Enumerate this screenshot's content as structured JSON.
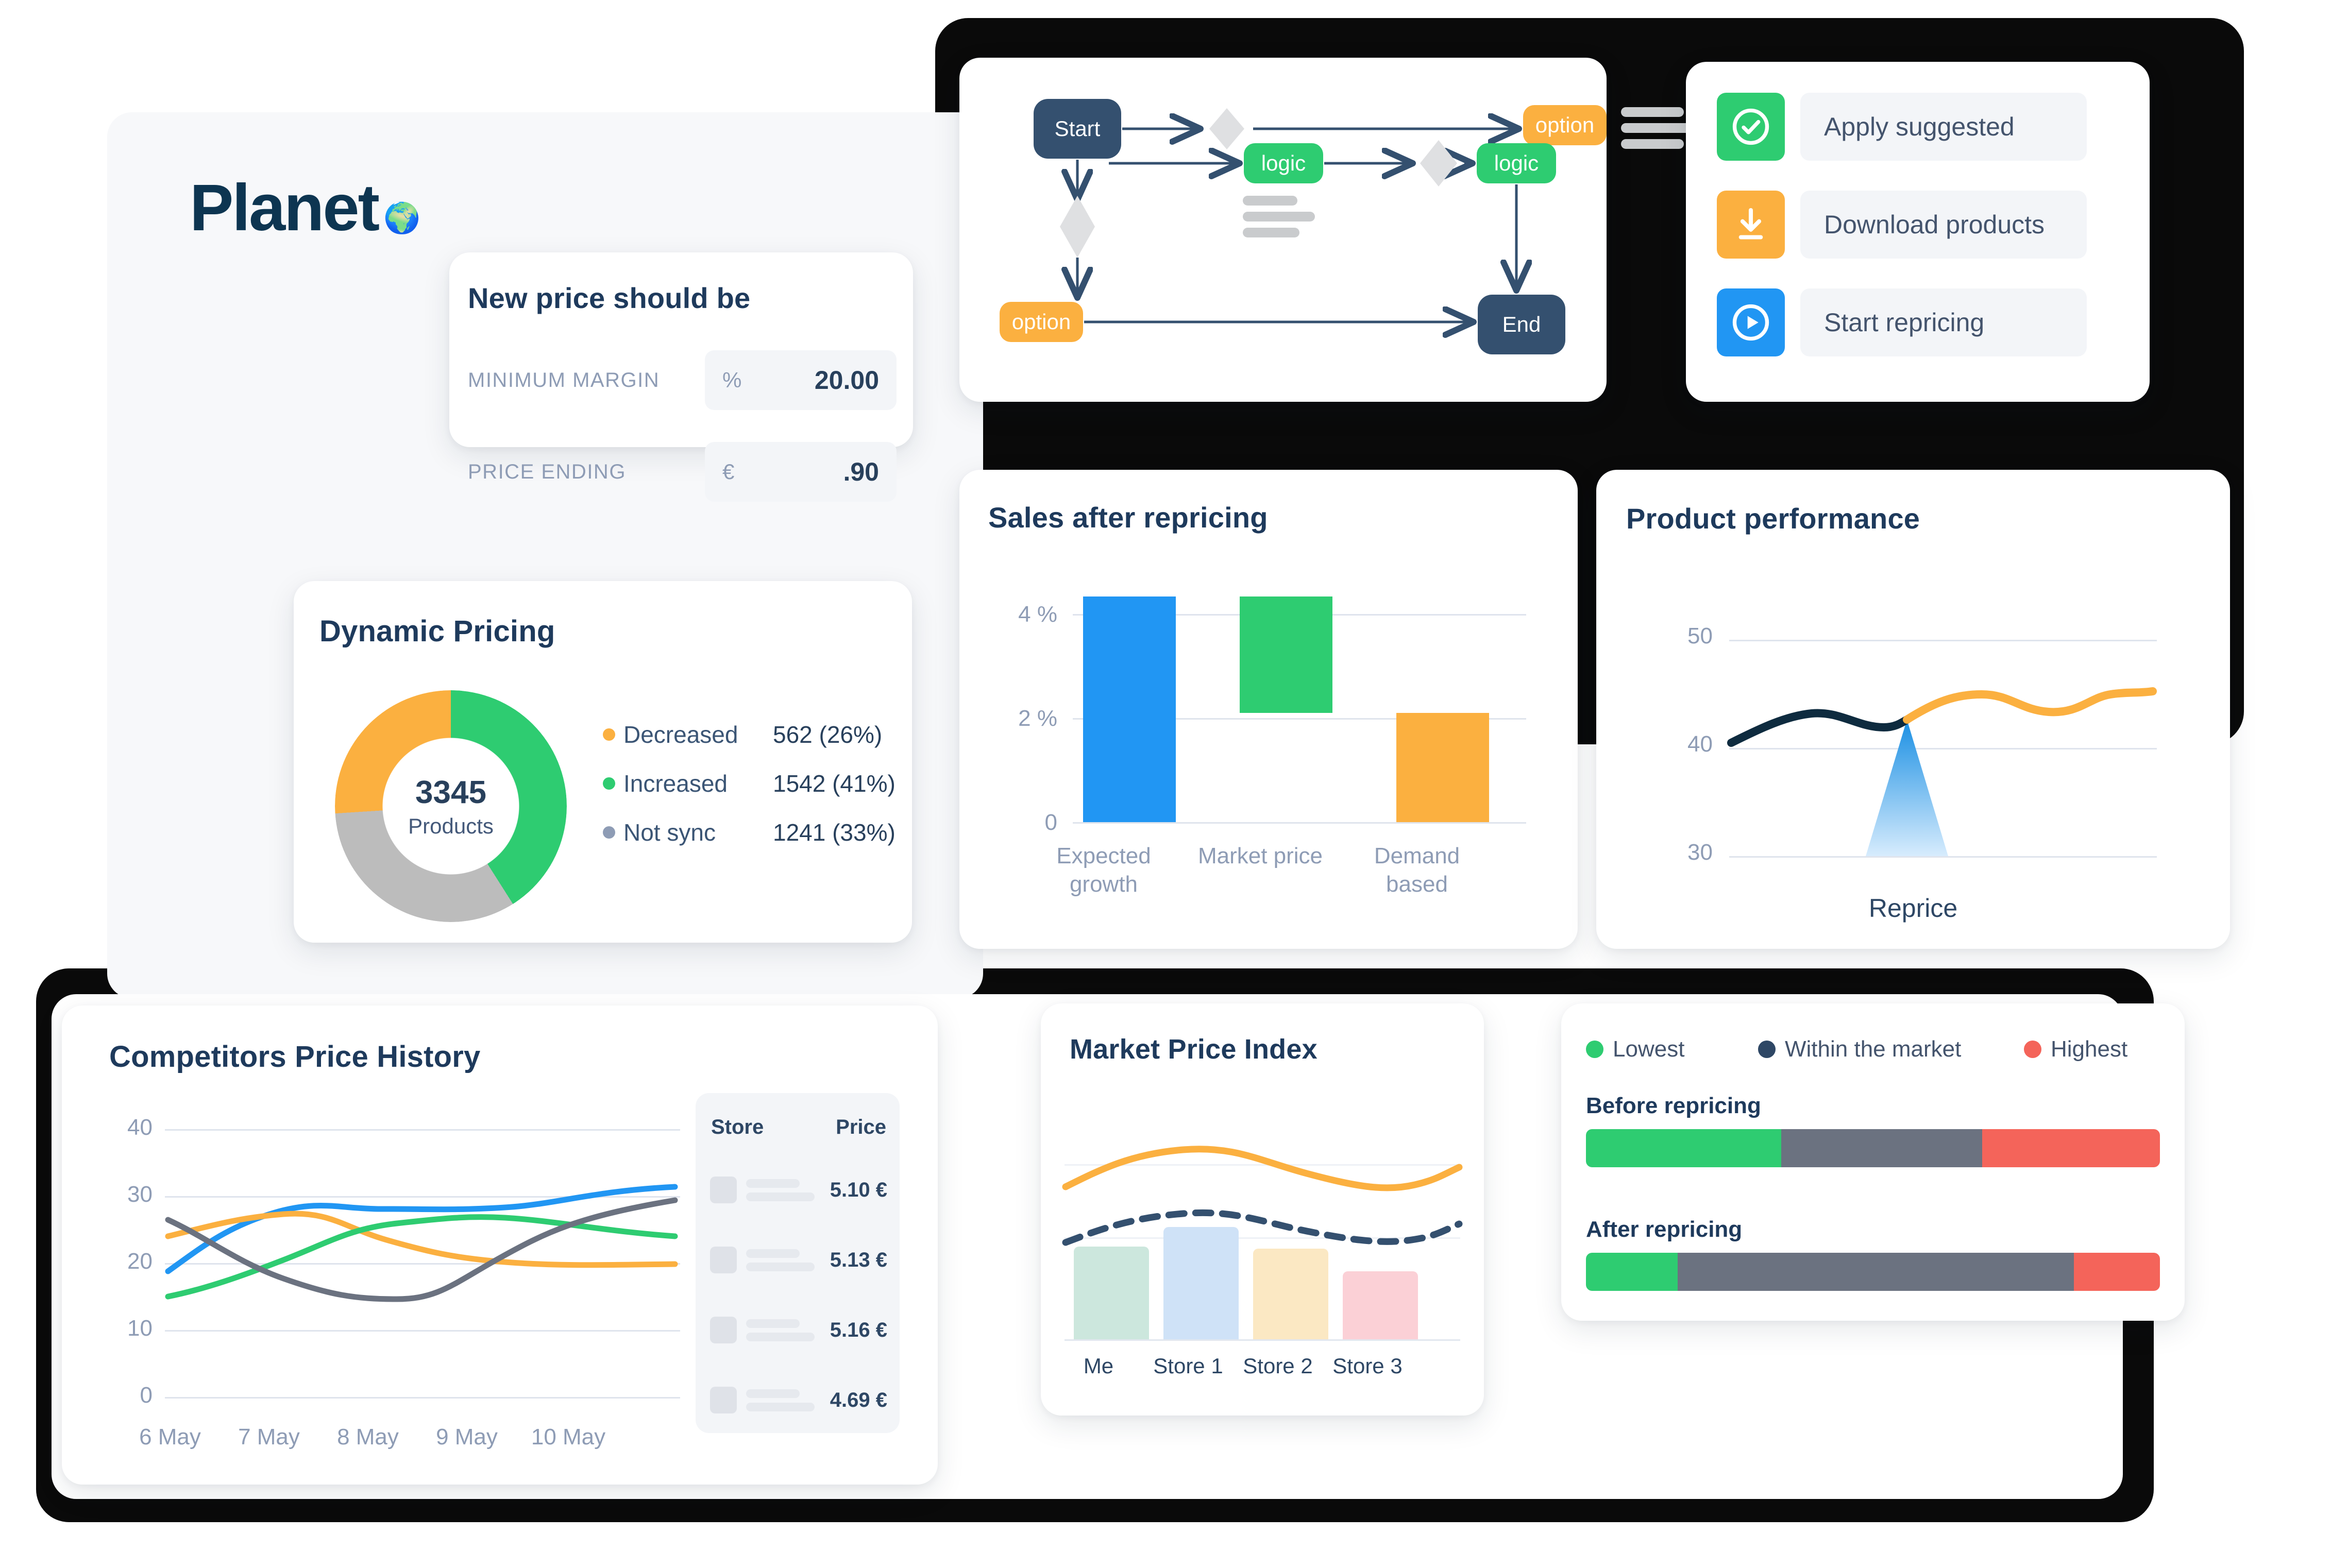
{
  "brand": {
    "name": "Planet",
    "dot_icon": "globe-emoji",
    "color": "#0d3551"
  },
  "new_price_card": {
    "title": "New price should be",
    "fields": [
      {
        "label": "MINIMUM MARGIN",
        "unit": "%",
        "value": "20.00"
      },
      {
        "label": "PRICE ENDING",
        "unit": "€",
        "value": ".90"
      }
    ]
  },
  "flow_card": {
    "nodes": [
      {
        "id": "start",
        "label": "Start",
        "type": "terminator",
        "color": "#34506f"
      },
      {
        "id": "opt1",
        "label": "option",
        "type": "option",
        "color": "#fbb040"
      },
      {
        "id": "opt2",
        "label": "option",
        "type": "option",
        "color": "#fbb040"
      },
      {
        "id": "logic1",
        "label": "logic",
        "type": "logic",
        "color": "#2ecc71"
      },
      {
        "id": "logic2",
        "label": "logic",
        "type": "logic",
        "color": "#2ecc71"
      },
      {
        "id": "end",
        "label": "End",
        "type": "terminator",
        "color": "#34506f"
      }
    ],
    "decision_count": 3,
    "arrow_color": "#34506f"
  },
  "actions_card": {
    "items": [
      {
        "label": "Apply suggested",
        "icon": "check-circle-icon",
        "color": "#2ecc71"
      },
      {
        "label": "Download products",
        "icon": "download-icon",
        "color": "#fbb040"
      },
      {
        "label": "Start repricing",
        "icon": "play-circle-icon",
        "color": "#2196f3"
      }
    ]
  },
  "dynamic_pricing": {
    "title": "Dynamic Pricing",
    "center_value": "3345",
    "center_label": "Products",
    "legend": [
      {
        "name": "Decreased",
        "value": "562 (26%)",
        "color": "#fbb040"
      },
      {
        "name": "Increased",
        "value": "1542 (41%)",
        "color": "#2ecc71"
      },
      {
        "name": "Not sync",
        "value": "1241 (33%)",
        "color": "#8e9cb5"
      }
    ]
  },
  "store_table": {
    "columns": [
      "Store",
      "Price"
    ],
    "rows": [
      {
        "store": "",
        "price": "5.10 €"
      },
      {
        "store": "",
        "price": "5.13 €"
      },
      {
        "store": "",
        "price": "5.16 €"
      },
      {
        "store": "",
        "price": "4.69 €"
      }
    ]
  },
  "reprice_compare": {
    "legend": [
      {
        "label": "Lowest",
        "color": "#2ecc71"
      },
      {
        "label": "Within the market",
        "color": "#2e4765"
      },
      {
        "label": "Highest",
        "color": "#f4645a"
      }
    ],
    "before_heading": "Before repricing",
    "after_heading": "After repricing",
    "before": [
      34,
      35,
      31
    ],
    "after": [
      16,
      69,
      15
    ]
  },
  "chart_data": [
    {
      "id": "dynamic-pricing-donut",
      "type": "pie",
      "title": "Dynamic Pricing",
      "categories": [
        "Increased",
        "Not sync",
        "Decreased"
      ],
      "values": [
        41,
        33,
        26
      ],
      "counts": [
        1542,
        1241,
        562
      ],
      "colors": [
        "#2ecc71",
        "#bcbcbc",
        "#fbb040"
      ],
      "center_value": 3345,
      "center_label": "Products",
      "legend_position": "right",
      "donut": true
    },
    {
      "id": "sales-after-repricing",
      "type": "bar",
      "title": "Sales after repricing",
      "categories": [
        "Expected growth",
        "Market price",
        "Demand based"
      ],
      "ranges": [
        [
          0,
          4.3
        ],
        [
          2.1,
          4.3
        ],
        [
          0,
          2.1
        ]
      ],
      "colors": [
        "#2196f3",
        "#2ecc71",
        "#fbb040"
      ],
      "xlabel": "",
      "ylabel": "",
      "ylim": [
        0,
        4.8
      ],
      "yticks": [
        "0",
        "2 %",
        "4 %"
      ],
      "ytick_values": [
        0,
        2,
        4
      ],
      "grid": true
    },
    {
      "id": "product-performance",
      "type": "line",
      "title": "Product performance",
      "ylim": [
        28,
        52
      ],
      "yticks": [
        "30",
        "40",
        "50"
      ],
      "ytick_values": [
        30,
        40,
        50
      ],
      "annotation": "Reprice",
      "grid": true,
      "series": [
        {
          "name": "before",
          "color": "#0e2b3f",
          "values": [
            40.8,
            42.5,
            43.6,
            43.4,
            42.9,
            42.7
          ]
        },
        {
          "name": "after",
          "color": "#fbb040",
          "values": [
            42.7,
            44.3,
            45.2,
            44.7,
            44.3,
            45.5
          ]
        }
      ],
      "marker": {
        "type": "triangle",
        "label": "Reprice",
        "color_top": "#1a8fe3",
        "color_bottom": "#cfe7fb"
      }
    },
    {
      "id": "competitors-price-history",
      "type": "line",
      "title": "Competitors Price History",
      "x": [
        "6 May",
        "7 May",
        "8 May",
        "9 May",
        "10 May"
      ],
      "ylim": [
        0,
        42
      ],
      "yticks": [
        "0",
        "10",
        "20",
        "30",
        "40"
      ],
      "ytick_values": [
        0,
        10,
        20,
        30,
        40
      ],
      "grid": true,
      "series": [
        {
          "name": "series-blue",
          "color": "#2196f3",
          "values": [
            18.8,
            25.5,
            27.8,
            27.3,
            28.5,
            30.5
          ]
        },
        {
          "name": "series-orange",
          "color": "#fbb040",
          "values": [
            24.0,
            27.3,
            26.2,
            22.8,
            21.5,
            21.3
          ]
        },
        {
          "name": "series-green",
          "color": "#2ecc71",
          "values": [
            15.0,
            19.2,
            23.4,
            25.4,
            25.2,
            24.0
          ]
        },
        {
          "name": "series-gray",
          "color": "#6b7280",
          "values": [
            26.5,
            22.0,
            17.8,
            16.8,
            21.5,
            27.2
          ]
        }
      ]
    },
    {
      "id": "market-price-index",
      "type": "bar",
      "title": "Market Price Index",
      "categories": [
        "Me",
        "Store 1",
        "Store 2",
        "Store 3"
      ],
      "values": [
        62,
        74,
        60,
        45
      ],
      "colors": [
        "#cce7dd",
        "#cfe2f7",
        "#fbe8c3",
        "#fbd0d6"
      ],
      "grid": true,
      "overlay_series": [
        {
          "name": "market-line",
          "style": "solid",
          "color": "#fbb040",
          "values": [
            70,
            84,
            88,
            82,
            70,
            66,
            78
          ]
        },
        {
          "name": "trend-line",
          "style": "dashed",
          "color": "#34506f",
          "values": [
            44,
            58,
            64,
            60,
            48,
            40,
            50
          ]
        }
      ]
    }
  ]
}
